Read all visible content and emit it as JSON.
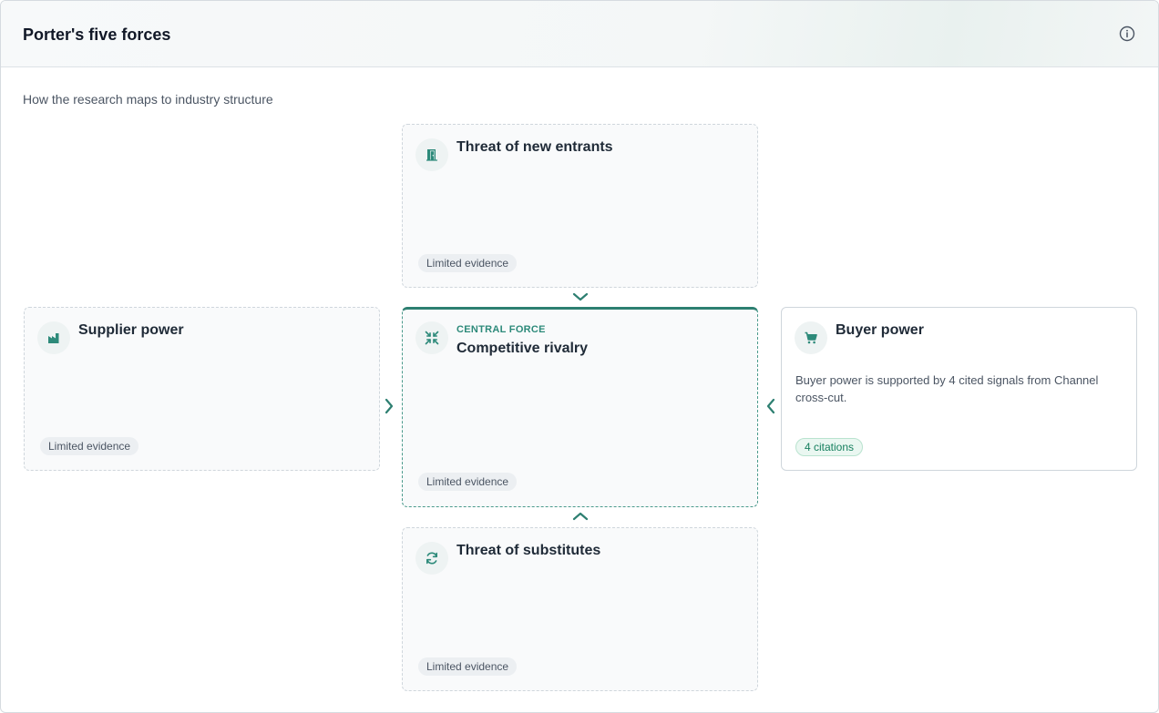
{
  "header": {
    "title": "Porter's five forces",
    "info_icon": "info-circle-icon"
  },
  "subtitle": "How the research maps to industry structure",
  "accent_color": "#2d8a7a",
  "forces": {
    "new_entrants": {
      "title": "Threat of new entrants",
      "icon": "door-icon",
      "badge": "Limited evidence"
    },
    "supplier": {
      "title": "Supplier power",
      "icon": "factory-icon",
      "badge": "Limited evidence"
    },
    "rivalry": {
      "eyebrow": "CENTRAL FORCE",
      "title": "Competitive rivalry",
      "icon": "compress-arrows-icon",
      "badge": "Limited evidence"
    },
    "buyer": {
      "title": "Buyer power",
      "icon": "cart-icon",
      "description": "Buyer power is supported by 4 cited signals from Channel cross-cut.",
      "badge": "4 citations"
    },
    "substitutes": {
      "title": "Threat of substitutes",
      "icon": "refresh-icon",
      "badge": "Limited evidence"
    }
  }
}
